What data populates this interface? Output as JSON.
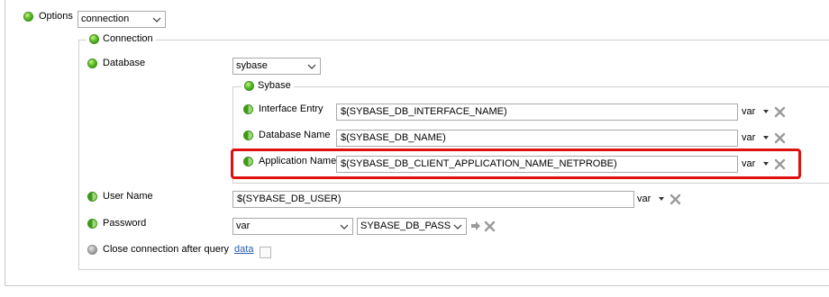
{
  "options": {
    "label": "Options",
    "selected": "connection"
  },
  "connection": {
    "legend": "Connection",
    "database": {
      "label": "Database",
      "selected": "sybase"
    },
    "sybase": {
      "legend": "Sybase",
      "rows": [
        {
          "label": "Interface Entry",
          "value": "$(SYBASE_DB_INTERFACE_NAME)",
          "var_label": "var"
        },
        {
          "label": "Database Name",
          "value": "$(SYBASE_DB_NAME)",
          "var_label": "var"
        },
        {
          "label": "Application Name",
          "value": "$(SYBASE_DB_CLIENT_APPLICATION_NAME_NETPROBE)",
          "var_label": "var"
        }
      ]
    },
    "user_name": {
      "label": "User Name",
      "value": "$(SYBASE_DB_USER)",
      "var_label": "var"
    },
    "password": {
      "label": "Password",
      "type_selected": "var",
      "var_selected": "SYBASE_DB_PASS"
    },
    "close_connection": {
      "label": "Close connection after query",
      "link": "data",
      "checked": false
    }
  },
  "icons": {
    "status_on": "green-dot-icon",
    "status_partial": "half-green-dot-icon",
    "status_off": "gray-dot-icon",
    "remove": "x-icon",
    "dropdown": "chevron-down-icon",
    "arrow": "arrow-right-icon"
  },
  "colors": {
    "highlight": "#e01010",
    "link": "#2a5db0",
    "status_green": "#5fbf28"
  }
}
